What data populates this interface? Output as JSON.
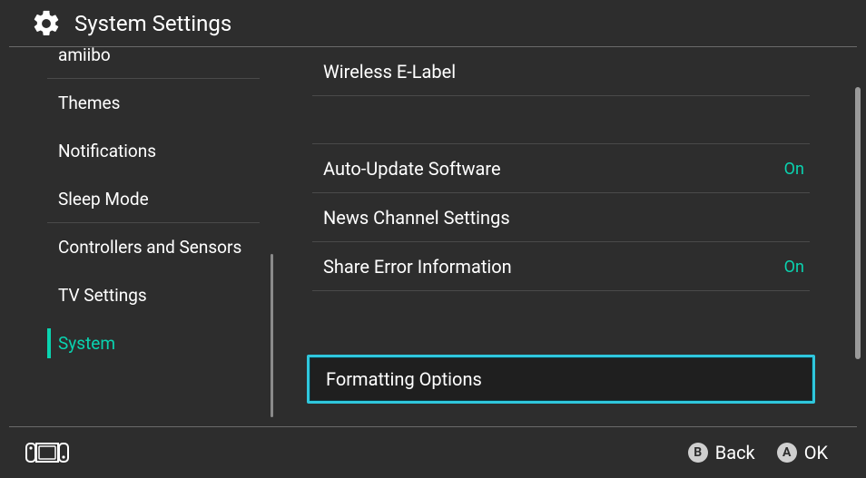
{
  "header": {
    "title": "System Settings"
  },
  "sidebar": {
    "items": [
      {
        "label": "amiibo",
        "divider": true
      },
      {
        "label": "Themes"
      },
      {
        "label": "Notifications"
      },
      {
        "label": "Sleep Mode",
        "divider": true
      },
      {
        "label": "Controllers and Sensors"
      },
      {
        "label": "TV Settings"
      },
      {
        "label": "System",
        "selected": true
      }
    ]
  },
  "content": {
    "rows": [
      {
        "label": "Wireless E-Label"
      },
      {
        "label": "Auto-Update Software",
        "value": "On"
      },
      {
        "label": "News Channel Settings"
      },
      {
        "label": "Share Error Information",
        "value": "On"
      },
      {
        "label": "Formatting Options",
        "highlighted": true
      }
    ]
  },
  "footer": {
    "hints": [
      {
        "button": "B",
        "label": "Back"
      },
      {
        "button": "A",
        "label": "OK"
      }
    ]
  },
  "colors": {
    "accent": "#0ad3b0",
    "highlight": "#2fc7dd",
    "bg": "#2d2d2d"
  }
}
